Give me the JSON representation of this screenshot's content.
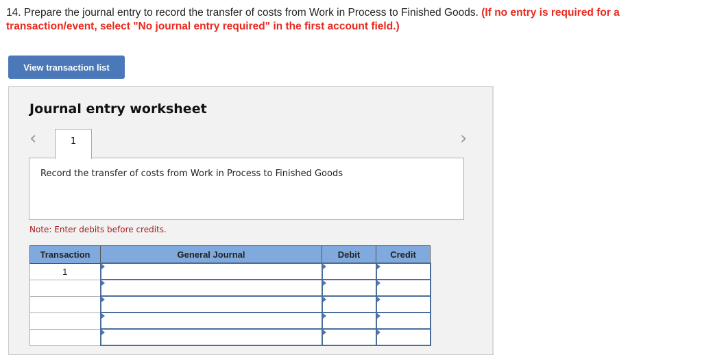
{
  "question": {
    "number": "14.",
    "text": "Prepare the journal entry to record the transfer of costs from Work in Process to Finished Goods.",
    "instruction": "(If no entry is required for a transaction/event, select \"No journal entry required\" in the first account field.)"
  },
  "view_transaction_list_label": "View transaction list",
  "worksheet": {
    "title": "Journal entry worksheet",
    "active_tab": "1",
    "description": "Record the transfer of costs from Work in Process to Finished Goods",
    "note": "Note: Enter debits before credits.",
    "nav_prev": "‹",
    "nav_next": "›",
    "columns": [
      "Transaction",
      "General Journal",
      "Debit",
      "Credit"
    ],
    "rows": [
      {
        "transaction": "1",
        "account": "",
        "debit": "",
        "credit": ""
      },
      {
        "transaction": "",
        "account": "",
        "debit": "",
        "credit": ""
      },
      {
        "transaction": "",
        "account": "",
        "debit": "",
        "credit": ""
      },
      {
        "transaction": "",
        "account": "",
        "debit": "",
        "credit": ""
      },
      {
        "transaction": "",
        "account": "",
        "debit": "",
        "credit": ""
      }
    ]
  }
}
